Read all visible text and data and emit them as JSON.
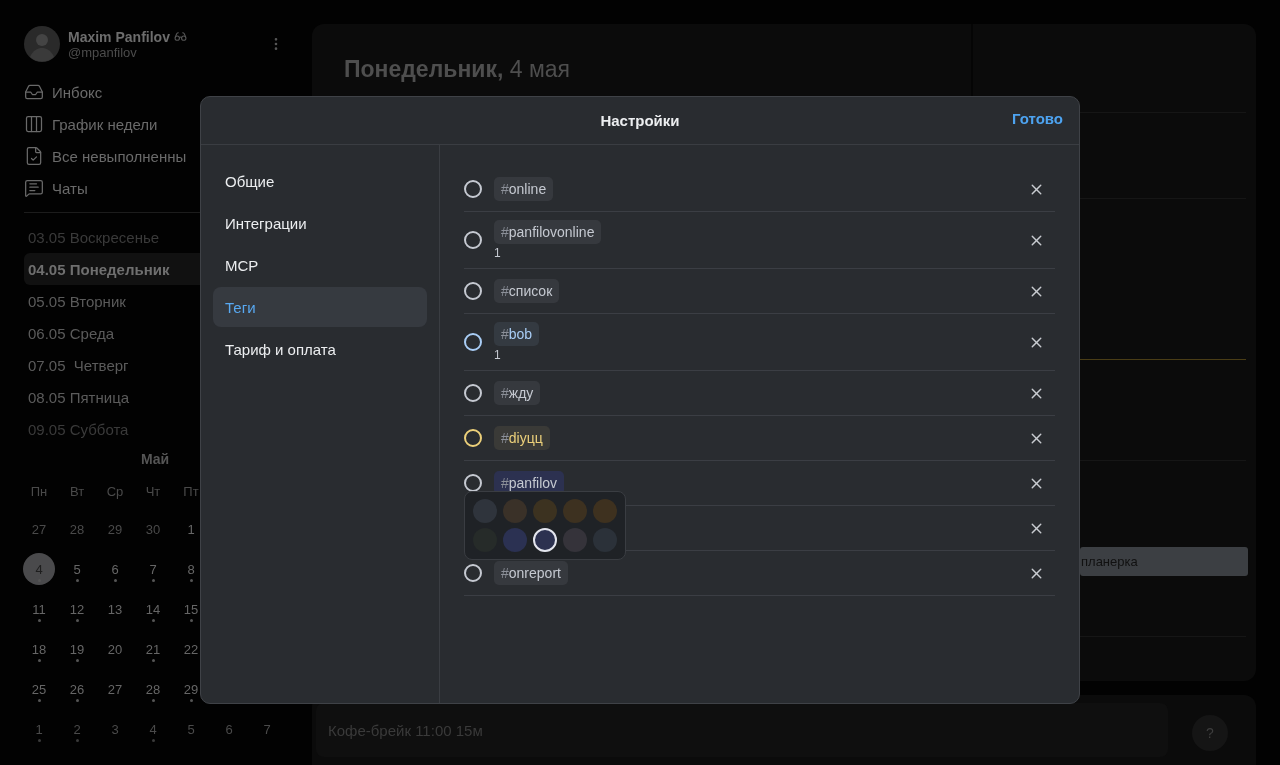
{
  "profile": {
    "name": "Maxim Panfilov",
    "handle": "@mpanfilov"
  },
  "nav": [
    {
      "kind": "inbox",
      "label": "Инбокс"
    },
    {
      "kind": "week",
      "label": "График недели"
    },
    {
      "kind": "todo",
      "label": "Все невыполненны"
    },
    {
      "kind": "chats",
      "label": "Чаты"
    }
  ],
  "days": [
    {
      "label": "03.05 Воскресенье",
      "muted": true,
      "selected": false
    },
    {
      "label": "04.05 Понедельник",
      "muted": false,
      "selected": true
    },
    {
      "label": "05.05 Вторник",
      "muted": false,
      "selected": false
    },
    {
      "label": "06.05 Среда",
      "muted": false,
      "selected": false
    },
    {
      "label": "07.05  Четверг",
      "muted": false,
      "selected": false
    },
    {
      "label": "08.05 Пятница",
      "muted": false,
      "selected": false
    },
    {
      "label": "09.05 Суббота",
      "muted": true,
      "selected": false
    }
  ],
  "calendar": {
    "month": "Май",
    "weekdays": [
      "Пн",
      "Вт",
      "Ср",
      "Чт",
      "Пт"
    ],
    "weeks": [
      [
        {
          "day": "27",
          "muted": true,
          "dot": false,
          "selected": false
        },
        {
          "day": "28",
          "muted": true,
          "dot": false,
          "selected": false
        },
        {
          "day": "29",
          "muted": true,
          "dot": false,
          "selected": false
        },
        {
          "day": "30",
          "muted": true,
          "dot": false,
          "selected": false
        },
        {
          "day": "1",
          "muted": false,
          "dot": false,
          "selected": false
        }
      ],
      [
        {
          "day": "4",
          "muted": false,
          "dot": true,
          "selected": true
        },
        {
          "day": "5",
          "muted": false,
          "dot": true,
          "selected": false
        },
        {
          "day": "6",
          "muted": false,
          "dot": true,
          "selected": false
        },
        {
          "day": "7",
          "muted": false,
          "dot": true,
          "selected": false
        },
        {
          "day": "8",
          "muted": false,
          "dot": true,
          "selected": false
        }
      ],
      [
        {
          "day": "11",
          "muted": false,
          "dot": true,
          "selected": false
        },
        {
          "day": "12",
          "muted": false,
          "dot": true,
          "selected": false
        },
        {
          "day": "13",
          "muted": false,
          "dot": false,
          "selected": false
        },
        {
          "day": "14",
          "muted": false,
          "dot": true,
          "selected": false
        },
        {
          "day": "15",
          "muted": false,
          "dot": true,
          "selected": false
        }
      ],
      [
        {
          "day": "18",
          "muted": false,
          "dot": true,
          "selected": false
        },
        {
          "day": "19",
          "muted": false,
          "dot": true,
          "selected": false
        },
        {
          "day": "20",
          "muted": false,
          "dot": false,
          "selected": false
        },
        {
          "day": "21",
          "muted": false,
          "dot": true,
          "selected": false
        },
        {
          "day": "22",
          "muted": false,
          "dot": false,
          "selected": false
        }
      ],
      [
        {
          "day": "25",
          "muted": false,
          "dot": true,
          "selected": false
        },
        {
          "day": "26",
          "muted": false,
          "dot": true,
          "selected": false
        },
        {
          "day": "27",
          "muted": false,
          "dot": false,
          "selected": false
        },
        {
          "day": "28",
          "muted": false,
          "dot": true,
          "selected": false
        },
        {
          "day": "29",
          "muted": false,
          "dot": true,
          "selected": false
        }
      ],
      [
        {
          "day": "1",
          "muted": true,
          "dot": true,
          "selected": false
        },
        {
          "day": "2",
          "muted": true,
          "dot": true,
          "selected": false
        },
        {
          "day": "3",
          "muted": true,
          "dot": false,
          "selected": false
        },
        {
          "day": "4",
          "muted": true,
          "dot": true,
          "selected": false
        },
        {
          "day": "5",
          "muted": true,
          "dot": false,
          "selected": false
        },
        {
          "day": "6",
          "muted": true,
          "dot": false,
          "selected": false
        },
        {
          "day": "7",
          "muted": true,
          "dot": false,
          "selected": false
        }
      ]
    ]
  },
  "day_view": {
    "title": "**Понедельник,** 4 мая",
    "event": "планерка"
  },
  "composer": {
    "placeholder": "Кофе-брейк 11:00 15м",
    "help": "?"
  },
  "settings": {
    "title": "Настройки",
    "done": "Готово",
    "sections": [
      {
        "label": "Общие",
        "selected": false
      },
      {
        "label": "Интеграции",
        "selected": false
      },
      {
        "label": "MCP",
        "selected": false
      },
      {
        "label": "Теги",
        "selected": true
      },
      {
        "label": "Тариф и оплата",
        "selected": false
      }
    ],
    "tags": [
      {
        "kind": "tag",
        "prefix": "#",
        "name": "online",
        "color": "#c5c9d1"
      },
      {
        "kind": "tag",
        "prefix": "#",
        "name": "panfilovonline",
        "count": "1",
        "color": "#c5c9d1"
      },
      {
        "kind": "tag",
        "prefix": "#",
        "name": "список",
        "color": "#c5c9d1"
      },
      {
        "kind": "tag",
        "prefix": "#",
        "name": "bob",
        "count": "1",
        "color": "#a9cdf5"
      },
      {
        "kind": "tag",
        "prefix": "#",
        "name": "жду",
        "color": "#c5c9d1"
      },
      {
        "kind": "tag",
        "prefix": "#",
        "name": "diyцц",
        "color": "#ecd07a"
      },
      {
        "kind": "tag",
        "prefix": "#",
        "name": "panfilov",
        "color": "#c5c9d1",
        "color_picker": [
          {
            "color": "#2f343c",
            "selected": false
          },
          {
            "color": "#3a3128",
            "selected": false
          },
          {
            "color": "#3c3220",
            "selected": false
          },
          {
            "color": "#3d3120",
            "selected": false
          },
          {
            "color": "#3e311f",
            "selected": false
          },
          {
            "color": "#262b29",
            "selected": false
          },
          {
            "color": "#2b3152",
            "selected": false
          },
          {
            "color": "#2c3150",
            "selected": true
          },
          {
            "color": "#35333a",
            "selected": false
          },
          {
            "color": "#2b3139",
            "selected": false
          }
        ]
      },
      {
        "kind": "covered"
      },
      {
        "kind": "tag",
        "prefix": "#",
        "name": "onreport",
        "color": "#c5c9d1"
      }
    ]
  }
}
